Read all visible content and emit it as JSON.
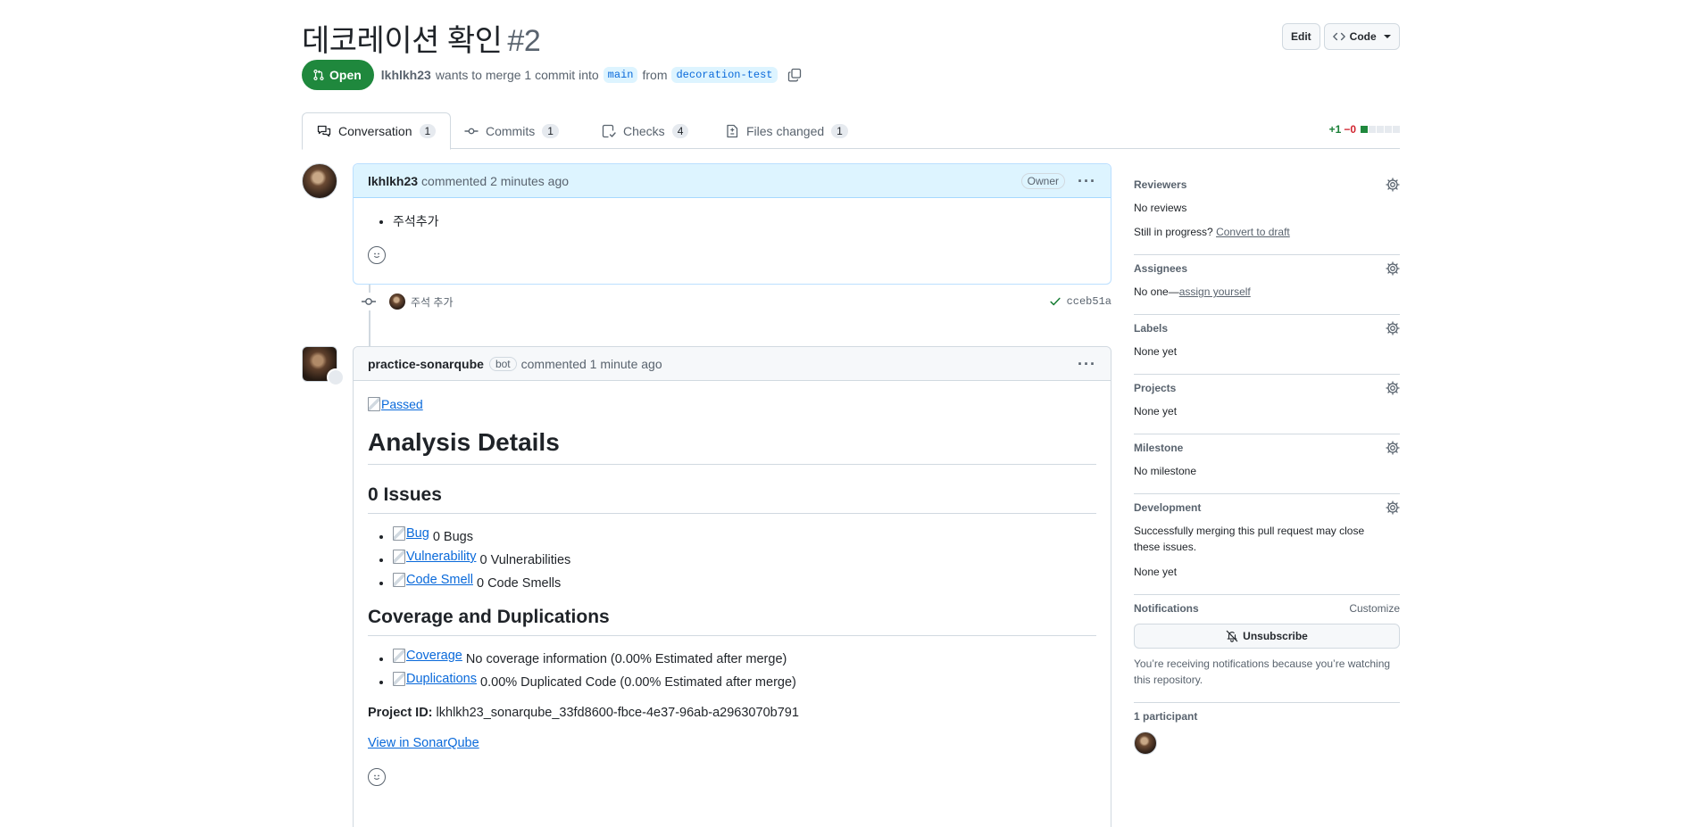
{
  "header": {
    "title": "데코레이션 확인",
    "number": "#2",
    "edit_label": "Edit",
    "code_label": "Code"
  },
  "state": {
    "label": "Open",
    "author": "lkhlkh23",
    "merge_text": "wants to merge 1 commit into",
    "base_branch": "main",
    "from_text": "from",
    "head_branch": "decoration-test"
  },
  "tabs": [
    {
      "label": "Conversation",
      "count": "1",
      "icon": "comment-discussion-icon"
    },
    {
      "label": "Commits",
      "count": "1",
      "icon": "git-commit-icon"
    },
    {
      "label": "Checks",
      "count": "4",
      "icon": "checklist-icon"
    },
    {
      "label": "Files changed",
      "count": "1",
      "icon": "file-diff-icon"
    }
  ],
  "diffstat": {
    "additions": "+1",
    "deletions": "−0",
    "blocks_filled": 1,
    "blocks_total": 5
  },
  "comment1": {
    "author": "lkhlkh23",
    "meta": "commented 2 minutes ago",
    "role": "Owner",
    "items": [
      "주석추가"
    ]
  },
  "commit": {
    "message": "주석 추가",
    "sha": "cceb51a",
    "status": "success"
  },
  "comment2": {
    "author": "practice-sonarqube",
    "bot_label": "bot",
    "meta": "commented 1 minute ago",
    "passed_alt": "Passed",
    "h1": "Analysis Details",
    "issues_heading": "0 Issues",
    "issues": [
      {
        "alt": "Bug",
        "text": "0 Bugs"
      },
      {
        "alt": "Vulnerability",
        "text": "0 Vulnerabilities"
      },
      {
        "alt": "Code Smell",
        "text": "0 Code Smells"
      }
    ],
    "coverage_heading": "Coverage and Duplications",
    "coverage": [
      {
        "alt": "Coverage",
        "text": "No coverage information (0.00% Estimated after merge)"
      },
      {
        "alt": "Duplications",
        "text": "0.00% Duplicated Code (0.00% Estimated after merge)"
      }
    ],
    "project_label": "Project ID:",
    "project_id": "lkhlkh23_sonarqube_33fd8600-fbce-4e37-96ab-a2963070b791",
    "link_label": "View in SonarQube"
  },
  "sidebar": {
    "reviewers": {
      "title": "Reviewers",
      "value": "No reviews",
      "progress_text": "Still in progress?",
      "draft_link": "Convert to draft"
    },
    "assignees": {
      "title": "Assignees",
      "value": "No one—",
      "link": "assign yourself"
    },
    "labels": {
      "title": "Labels",
      "value": "None yet"
    },
    "projects": {
      "title": "Projects",
      "value": "None yet"
    },
    "milestone": {
      "title": "Milestone",
      "value": "No milestone"
    },
    "development": {
      "title": "Development",
      "desc": "Successfully merging this pull request may close these issues.",
      "value": "None yet"
    },
    "notifications": {
      "title": "Notifications",
      "customize": "Customize",
      "button": "Unsubscribe",
      "desc": "You’re receiving notifications because you’re watching this repository."
    },
    "participants": {
      "title": "1 participant"
    }
  }
}
